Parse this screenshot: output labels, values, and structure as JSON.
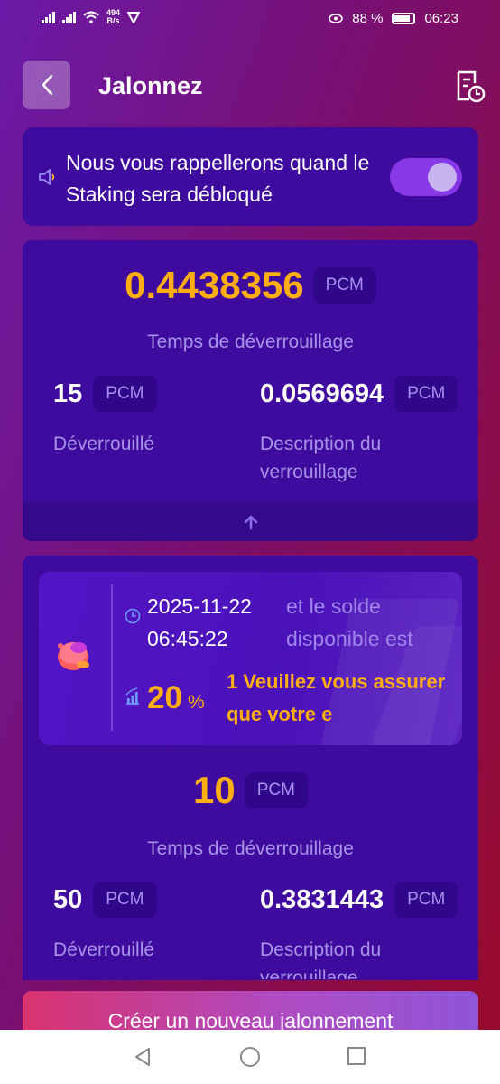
{
  "status_bar": {
    "net_speed_value": "494",
    "net_speed_unit": "B/s",
    "battery": "88 %",
    "time": "06:23"
  },
  "header": {
    "title": "Jalonnez"
  },
  "reminder": {
    "text": "Nous vous rappellerons quand le Staking sera débloqué",
    "toggle_on": true
  },
  "stake_summary": {
    "amount": "0.4438356",
    "unit": "PCM",
    "caption": "Temps de déverrouillage",
    "left_value": "15",
    "left_unit": "PCM",
    "left_label": "Déverrouillé",
    "right_value": "0.0569694",
    "right_unit": "PCM",
    "right_label": "Description du verrouillage"
  },
  "stake_entry": {
    "date": "2025-11-22",
    "time": "06:45:22",
    "note": "et le solde disponible est",
    "rate": "20",
    "rate_unit": "%",
    "warning": "1 Veuillez vous assurer que votre e",
    "amount": "10",
    "unit": "PCM",
    "caption": "Temps de déverrouillage",
    "left_value": "50",
    "left_unit": "PCM",
    "left_label": "Déverrouillé",
    "right_value": "0.3831443",
    "right_unit": "PCM",
    "right_label": "Description du verrouillage"
  },
  "cta": {
    "label": "Créer un nouveau jalonnement"
  },
  "colors": {
    "accent": "#ffae12",
    "card": "#3f0a9e",
    "muted_text": "#a593e8",
    "toggle": "#8838e6"
  }
}
